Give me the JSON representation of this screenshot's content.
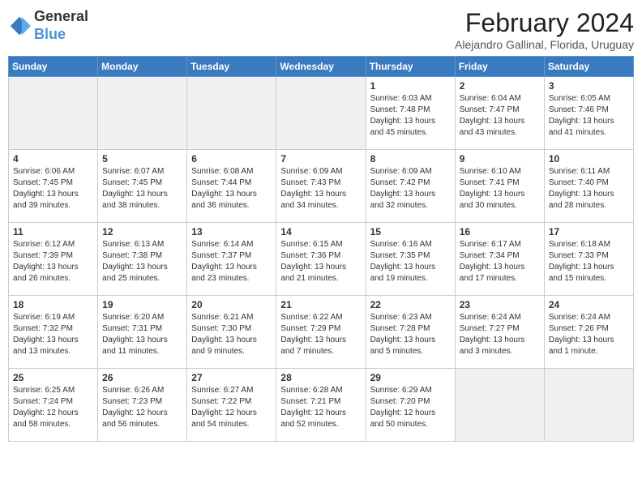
{
  "header": {
    "logo_general": "General",
    "logo_blue": "Blue",
    "month_year": "February 2024",
    "location": "Alejandro Gallinal, Florida, Uruguay"
  },
  "days_of_week": [
    "Sunday",
    "Monday",
    "Tuesday",
    "Wednesday",
    "Thursday",
    "Friday",
    "Saturday"
  ],
  "weeks": [
    [
      {
        "day": "",
        "info": "",
        "empty": true
      },
      {
        "day": "",
        "info": "",
        "empty": true
      },
      {
        "day": "",
        "info": "",
        "empty": true
      },
      {
        "day": "",
        "info": "",
        "empty": true
      },
      {
        "day": "1",
        "info": "Sunrise: 6:03 AM\nSunset: 7:48 PM\nDaylight: 13 hours\nand 45 minutes."
      },
      {
        "day": "2",
        "info": "Sunrise: 6:04 AM\nSunset: 7:47 PM\nDaylight: 13 hours\nand 43 minutes."
      },
      {
        "day": "3",
        "info": "Sunrise: 6:05 AM\nSunset: 7:46 PM\nDaylight: 13 hours\nand 41 minutes."
      }
    ],
    [
      {
        "day": "4",
        "info": "Sunrise: 6:06 AM\nSunset: 7:45 PM\nDaylight: 13 hours\nand 39 minutes."
      },
      {
        "day": "5",
        "info": "Sunrise: 6:07 AM\nSunset: 7:45 PM\nDaylight: 13 hours\nand 38 minutes."
      },
      {
        "day": "6",
        "info": "Sunrise: 6:08 AM\nSunset: 7:44 PM\nDaylight: 13 hours\nand 36 minutes."
      },
      {
        "day": "7",
        "info": "Sunrise: 6:09 AM\nSunset: 7:43 PM\nDaylight: 13 hours\nand 34 minutes."
      },
      {
        "day": "8",
        "info": "Sunrise: 6:09 AM\nSunset: 7:42 PM\nDaylight: 13 hours\nand 32 minutes."
      },
      {
        "day": "9",
        "info": "Sunrise: 6:10 AM\nSunset: 7:41 PM\nDaylight: 13 hours\nand 30 minutes."
      },
      {
        "day": "10",
        "info": "Sunrise: 6:11 AM\nSunset: 7:40 PM\nDaylight: 13 hours\nand 28 minutes."
      }
    ],
    [
      {
        "day": "11",
        "info": "Sunrise: 6:12 AM\nSunset: 7:39 PM\nDaylight: 13 hours\nand 26 minutes."
      },
      {
        "day": "12",
        "info": "Sunrise: 6:13 AM\nSunset: 7:38 PM\nDaylight: 13 hours\nand 25 minutes."
      },
      {
        "day": "13",
        "info": "Sunrise: 6:14 AM\nSunset: 7:37 PM\nDaylight: 13 hours\nand 23 minutes."
      },
      {
        "day": "14",
        "info": "Sunrise: 6:15 AM\nSunset: 7:36 PM\nDaylight: 13 hours\nand 21 minutes."
      },
      {
        "day": "15",
        "info": "Sunrise: 6:16 AM\nSunset: 7:35 PM\nDaylight: 13 hours\nand 19 minutes."
      },
      {
        "day": "16",
        "info": "Sunrise: 6:17 AM\nSunset: 7:34 PM\nDaylight: 13 hours\nand 17 minutes."
      },
      {
        "day": "17",
        "info": "Sunrise: 6:18 AM\nSunset: 7:33 PM\nDaylight: 13 hours\nand 15 minutes."
      }
    ],
    [
      {
        "day": "18",
        "info": "Sunrise: 6:19 AM\nSunset: 7:32 PM\nDaylight: 13 hours\nand 13 minutes."
      },
      {
        "day": "19",
        "info": "Sunrise: 6:20 AM\nSunset: 7:31 PM\nDaylight: 13 hours\nand 11 minutes."
      },
      {
        "day": "20",
        "info": "Sunrise: 6:21 AM\nSunset: 7:30 PM\nDaylight: 13 hours\nand 9 minutes."
      },
      {
        "day": "21",
        "info": "Sunrise: 6:22 AM\nSunset: 7:29 PM\nDaylight: 13 hours\nand 7 minutes."
      },
      {
        "day": "22",
        "info": "Sunrise: 6:23 AM\nSunset: 7:28 PM\nDaylight: 13 hours\nand 5 minutes."
      },
      {
        "day": "23",
        "info": "Sunrise: 6:24 AM\nSunset: 7:27 PM\nDaylight: 13 hours\nand 3 minutes."
      },
      {
        "day": "24",
        "info": "Sunrise: 6:24 AM\nSunset: 7:26 PM\nDaylight: 13 hours\nand 1 minute."
      }
    ],
    [
      {
        "day": "25",
        "info": "Sunrise: 6:25 AM\nSunset: 7:24 PM\nDaylight: 12 hours\nand 58 minutes."
      },
      {
        "day": "26",
        "info": "Sunrise: 6:26 AM\nSunset: 7:23 PM\nDaylight: 12 hours\nand 56 minutes."
      },
      {
        "day": "27",
        "info": "Sunrise: 6:27 AM\nSunset: 7:22 PM\nDaylight: 12 hours\nand 54 minutes."
      },
      {
        "day": "28",
        "info": "Sunrise: 6:28 AM\nSunset: 7:21 PM\nDaylight: 12 hours\nand 52 minutes."
      },
      {
        "day": "29",
        "info": "Sunrise: 6:29 AM\nSunset: 7:20 PM\nDaylight: 12 hours\nand 50 minutes."
      },
      {
        "day": "",
        "info": "",
        "empty": true
      },
      {
        "day": "",
        "info": "",
        "empty": true
      }
    ]
  ]
}
